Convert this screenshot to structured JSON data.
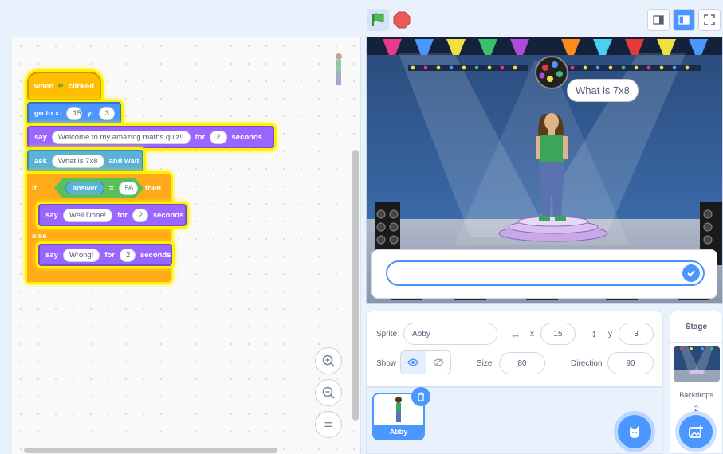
{
  "code": {
    "when_flag": {
      "word1": "when",
      "word2": "clicked"
    },
    "goto": {
      "label": "go to x:",
      "x": "15",
      "ylabel": "y:",
      "y": "3"
    },
    "say1": {
      "label": "say",
      "text": "Welcome to my amazing maths quiz!!",
      "for": "for",
      "secs": "2",
      "unit": "seconds"
    },
    "ask": {
      "label": "ask",
      "text": "What is 7x8",
      "suffix": "and wait"
    },
    "if_block": {
      "if": "if",
      "then": "then",
      "else": "else",
      "reporter": "answer",
      "op": "=",
      "value": "56"
    },
    "say2": {
      "label": "say",
      "text": "Well Done!",
      "for": "for",
      "secs": "2",
      "unit": "seconds"
    },
    "say3": {
      "label": "say",
      "text": "Wrong!",
      "for": "for",
      "secs": "2",
      "unit": "seconds"
    }
  },
  "zoom": {
    "in": "+",
    "out": "−",
    "reset": "="
  },
  "stage": {
    "speech": "What is 7x8"
  },
  "sprite_info": {
    "sprite_label": "Sprite",
    "sprite_name": "Abby",
    "x_label": "x",
    "x": "15",
    "y_label": "y",
    "y": "3",
    "show_label": "Show",
    "size_label": "Size",
    "size": "80",
    "direction_label": "Direction",
    "direction": "90"
  },
  "sprites": [
    {
      "name": "Abby"
    }
  ],
  "stage_panel": {
    "title": "Stage",
    "backdrops_label": "Backdrops",
    "backdrops_count": "2"
  },
  "colors": {
    "accent": "#4c97ff",
    "motion": "#4c97ff",
    "looks": "#9966ff",
    "control": "#ffab19",
    "events": "#ffbf00",
    "sensing": "#5cb1d6",
    "operators": "#59c059"
  }
}
